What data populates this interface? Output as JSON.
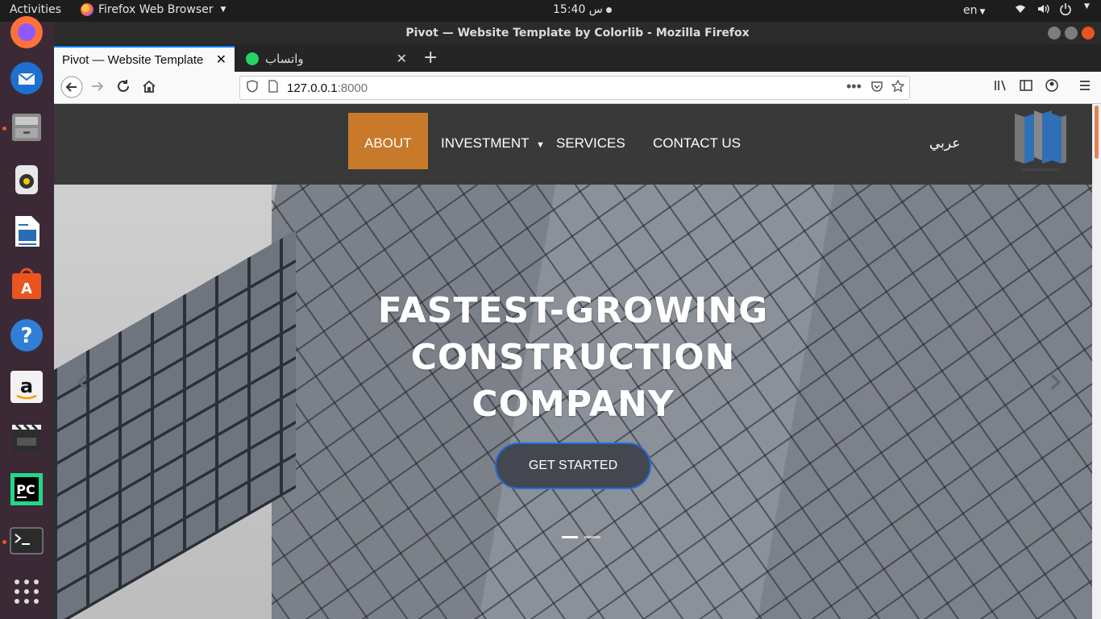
{
  "system_bar": {
    "activities": "Activities",
    "app_name": "Firefox Web Browser",
    "clock": "15:40 س",
    "language": "en"
  },
  "window": {
    "title": "Pivot — Website Template by Colorlib - Mozilla Firefox"
  },
  "tabs": [
    {
      "label": "Pivot — Website Template by Colorlib",
      "active": true
    },
    {
      "label": "واتساب",
      "active": false
    }
  ],
  "url": {
    "host": "127.0.0.1",
    "port": ":8000"
  },
  "site": {
    "nav": {
      "about": "ABOUT",
      "investment": "INVESTMENT",
      "services": "SERVICES",
      "contact": "CONTACT US",
      "language_switch": "عربي"
    },
    "hero": {
      "line1": "FASTEST-GROWING",
      "line2": "CONSTRUCTION",
      "line3": "COMPANY",
      "cta": "GET STARTED",
      "slide_count": 2,
      "active_slide": 1
    },
    "accent_color": "#c87a2a"
  },
  "icons": {
    "dock": [
      "firefox-icon",
      "thunderbird-icon",
      "files-icon",
      "rhythmbox-icon",
      "libreoffice-writer-icon",
      "software-center-icon",
      "help-icon",
      "amazon-icon",
      "video-editor-icon",
      "pycharm-icon",
      "terminal-icon",
      "show-apps-icon"
    ]
  }
}
